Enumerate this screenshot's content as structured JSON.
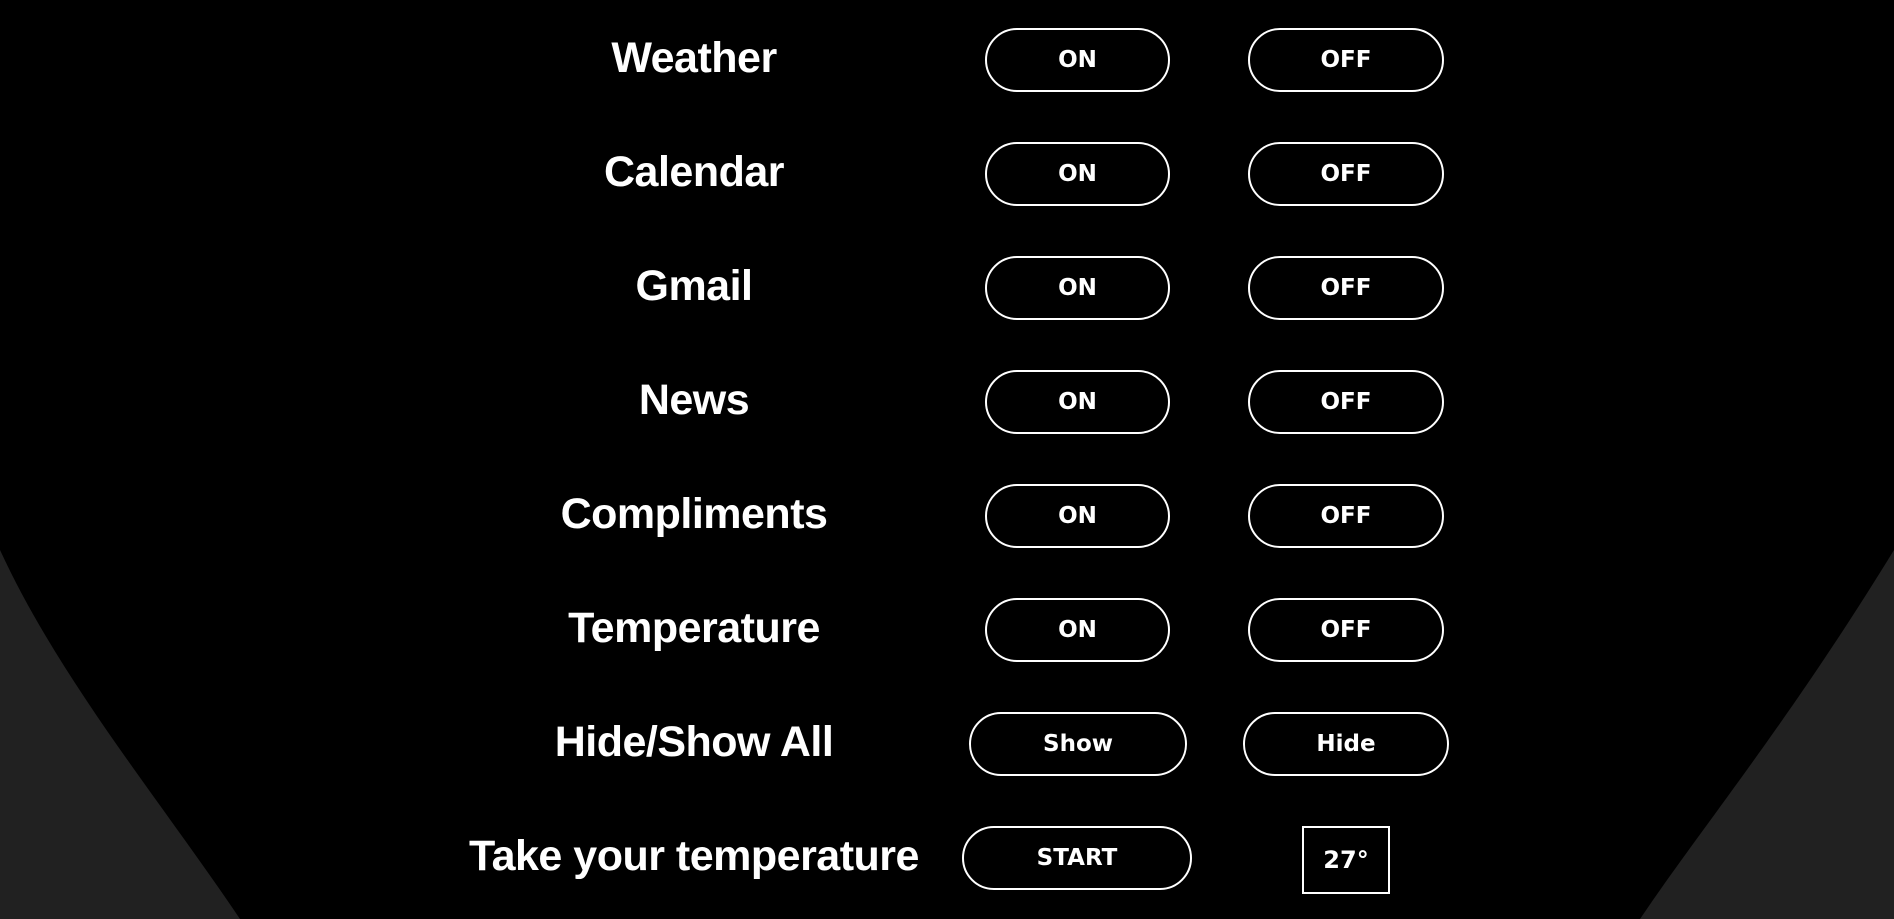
{
  "theme": {
    "page_background": "#212121",
    "panel_background": "#000000",
    "foreground": "#ffffff"
  },
  "modules": [
    {
      "label": "Weather",
      "on_label": "ON",
      "off_label": "OFF"
    },
    {
      "label": "Calendar",
      "on_label": "ON",
      "off_label": "OFF"
    },
    {
      "label": "Gmail",
      "on_label": "ON",
      "off_label": "OFF"
    },
    {
      "label": "News",
      "on_label": "ON",
      "off_label": "OFF"
    },
    {
      "label": "Compliments",
      "on_label": "ON",
      "off_label": "OFF"
    },
    {
      "label": "Temperature",
      "on_label": "ON",
      "off_label": "OFF"
    }
  ],
  "hide_show_all": {
    "label": "Hide/Show All",
    "show_label": "Show",
    "hide_label": "Hide"
  },
  "take_temperature": {
    "label": "Take your temperature",
    "start_label": "START",
    "reading": "27°"
  }
}
